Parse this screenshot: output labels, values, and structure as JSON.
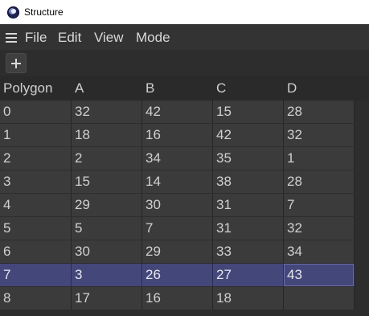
{
  "window": {
    "title": "Structure"
  },
  "menu": {
    "items": [
      "File",
      "Edit",
      "View",
      "Mode"
    ]
  },
  "table": {
    "headers": [
      "Polygon",
      "A",
      "B",
      "C",
      "D"
    ],
    "rows": [
      [
        "0",
        "32",
        "42",
        "15",
        "28"
      ],
      [
        "1",
        "18",
        "16",
        "42",
        "32"
      ],
      [
        "2",
        "2",
        "34",
        "35",
        "1"
      ],
      [
        "3",
        "15",
        "14",
        "38",
        "28"
      ],
      [
        "4",
        "29",
        "30",
        "31",
        "7"
      ],
      [
        "5",
        "5",
        "7",
        "31",
        "32"
      ],
      [
        "6",
        "30",
        "29",
        "33",
        "34"
      ],
      [
        "7",
        "3",
        "26",
        "27",
        "43"
      ],
      [
        "8",
        "17",
        "16",
        "18",
        ""
      ]
    ],
    "selected_row": 7,
    "active_column": 4
  },
  "colors": {
    "selection": "#44477a",
    "background": "#2d2d2d",
    "row": "#3b3b3b"
  }
}
